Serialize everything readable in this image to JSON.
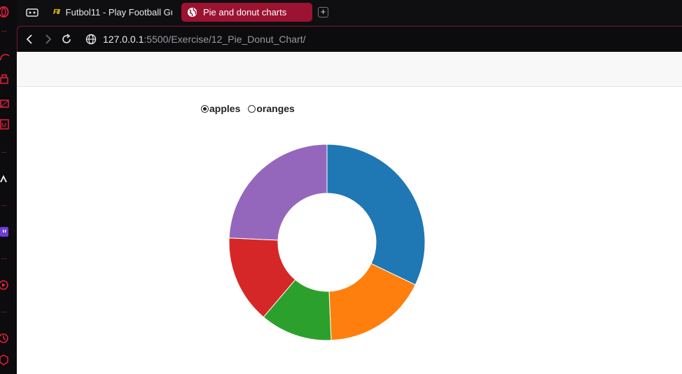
{
  "browser": {
    "tabs": [
      {
        "favicon": "FII",
        "title": "Futbol11 - Play Football Gu",
        "active": false
      },
      {
        "favicon": "globe-icon",
        "title": "Pie and donut charts",
        "active": true
      }
    ],
    "new_tab_label": "+",
    "url_host": "127.0.0.1",
    "url_path": ":5500/Exercise/12_Pie_Donut_Chart/"
  },
  "controls": {
    "options": [
      {
        "label": "apples",
        "checked": true
      },
      {
        "label": "oranges",
        "checked": false
      }
    ]
  },
  "chart_data": {
    "type": "pie",
    "subtype": "donut",
    "series": [
      {
        "values": [
          53245,
          28479,
          19697,
          24037,
          40245
        ]
      }
    ],
    "colors": [
      "#1f77b4",
      "#ff7f0e",
      "#2ca02c",
      "#d62728",
      "#9467bd"
    ]
  }
}
